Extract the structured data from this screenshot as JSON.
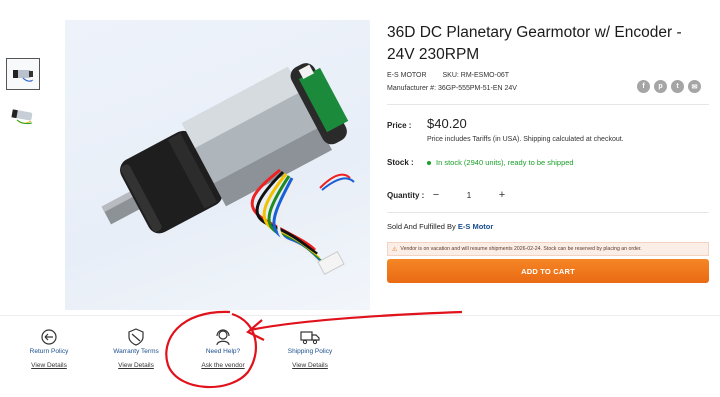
{
  "product": {
    "title": "36D DC Planetary Gearmotor w/ Encoder - 24V 230RPM",
    "brand": "E-S MOTOR",
    "sku": "SKU: RM-ESMO-06T",
    "manufacturer": "Manufacturer #: 36GP-555PM-51-EN 24V",
    "price_label": "Price :",
    "price": "$40.20",
    "price_note": "Price includes Tariffs (in USA).  Shipping calculated at checkout.",
    "stock_label": "Stock :",
    "stock_text": "In stock (2940 units), ready to be shipped",
    "quantity_label": "Quantity :",
    "quantity_value": "1",
    "minus": "−",
    "plus": "+",
    "sold_prefix": "Sold And Fulfilled By",
    "vendor": "E-S Motor",
    "vacation_notice": "Vendor is on vacation and will resume shipments 2026-02-24. Stock can be reserved by placing an order.",
    "add_to_cart": "ADD TO CART"
  },
  "share": [
    "f",
    "p",
    "t",
    "✉"
  ],
  "policies": [
    {
      "title": "Return Policy",
      "link": "View Details"
    },
    {
      "title": "Warranty Terms",
      "link": "View Details"
    },
    {
      "title": "Need Help?",
      "link": "Ask the vendor"
    },
    {
      "title": "Shipping Policy",
      "link": "View Details"
    }
  ],
  "colors": {
    "accent": "#ea6a14",
    "link": "#1b4e8e",
    "stock": "#1a9f29",
    "annotation": "#e0121b"
  }
}
